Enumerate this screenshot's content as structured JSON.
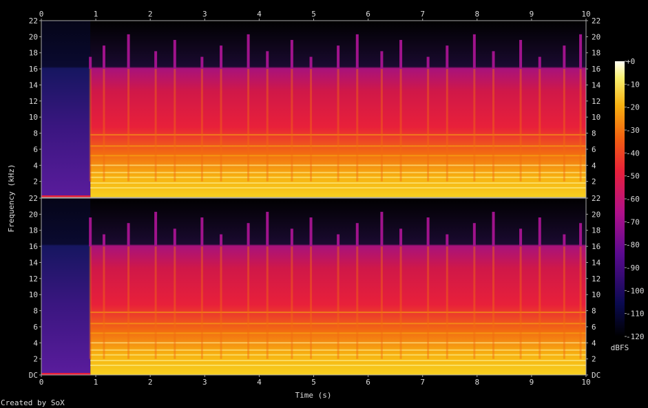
{
  "chart_data": {
    "type": "heatmap",
    "title": "",
    "xlabel": "Time (s)",
    "ylabel": "Frequency (kHz)",
    "xlim": [
      0,
      10
    ],
    "x_ticks": [
      "0",
      "1",
      "2",
      "3",
      "4",
      "5",
      "6",
      "7",
      "8",
      "9",
      "10"
    ],
    "ylim": [
      0,
      22
    ],
    "y_ticks_top": [
      "2",
      "4",
      "6",
      "8",
      "10",
      "12",
      "14",
      "16",
      "18",
      "20",
      "22"
    ],
    "y_ticks_bottom": [
      "DC",
      "2",
      "4",
      "6",
      "8",
      "10",
      "12",
      "14",
      "16",
      "18",
      "20",
      "22"
    ],
    "channels": 2,
    "colorbar": {
      "label": "dBFS",
      "ticks": [
        "+0",
        "-10",
        "-20",
        "-30",
        "-40",
        "-50",
        "-60",
        "-70",
        "-80",
        "-90",
        "-100",
        "-110",
        "-120"
      ],
      "range": [
        -120,
        0
      ]
    },
    "description_values": {
      "silence_end_s": 0.9,
      "content_cutoff_khz": 16,
      "transient_times_s": [
        0.9,
        1.15,
        1.6,
        2.1,
        2.45,
        2.95,
        3.3,
        3.8,
        4.15,
        4.6,
        4.95,
        5.45,
        5.8,
        6.25,
        6.6,
        7.1,
        7.45,
        7.95,
        8.3,
        8.8,
        9.15,
        9.6,
        9.9
      ]
    }
  },
  "credit": "Created by SoX",
  "colors": {
    "background": "#000000",
    "text": "#dddddd",
    "axis": "#aaaaaa"
  }
}
